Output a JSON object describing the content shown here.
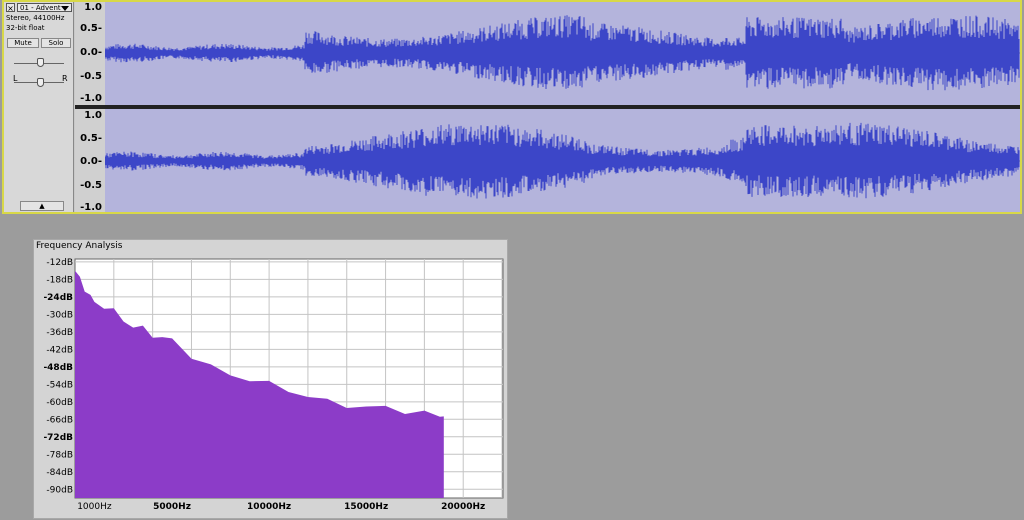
{
  "track": {
    "name": "01 - Advent",
    "info_line1": "Stereo, 44100Hz",
    "info_line2": "32-bit float",
    "mute_label": "Mute",
    "solo_label": "Solo",
    "gain_label_left": "L",
    "gain_label_right": "R",
    "close_glyph": "×",
    "collapse_glyph": "▲",
    "dropdown_icon": "triangle-down-icon",
    "ruler_ticks": [
      "1.0",
      "0.5-",
      "0.0-",
      "-0.5",
      "-1.0"
    ],
    "waveform_color": "#3c46c8",
    "waveform_bg": "#b4b4dc",
    "selection_border": "#d8d848"
  },
  "frequency_window": {
    "title": "Frequency Analysis",
    "fill_color": "#8c3cc8"
  },
  "chart_data": {
    "type": "area",
    "y_ticks": [
      "-12dB",
      "-18dB",
      "-24dB",
      "-30dB",
      "-36dB",
      "-42dB",
      "-48dB",
      "-54dB",
      "-60dB",
      "-66dB",
      "-72dB",
      "-78dB",
      "-84dB",
      "-90dB"
    ],
    "x_ticks": [
      "1000Hz",
      "5000Hz",
      "10000Hz",
      "15000Hz",
      "20000Hz"
    ],
    "x_tick_values": [
      1000,
      5000,
      10000,
      15000,
      20000
    ],
    "xlim": [
      0,
      22050
    ],
    "ylim": [
      -93,
      -11
    ],
    "series": [
      {
        "x": [
          0,
          250,
          500,
          800,
          1000,
          1500,
          2000,
          2500,
          3000,
          3500,
          4000,
          4500,
          5000,
          6000,
          7000,
          8000,
          9000,
          10000,
          11000,
          12000,
          13000,
          14000,
          15000,
          16000,
          17000,
          18000,
          18800,
          19000
        ],
        "y": [
          -15,
          -18,
          -21,
          -24,
          -26,
          -27,
          -29,
          -32,
          -34,
          -35,
          -37,
          -38,
          -39,
          -44,
          -48,
          -51,
          -52,
          -54,
          -56,
          -58,
          -60,
          -61,
          -62,
          -62,
          -63,
          -64,
          -65,
          -65
        ]
      }
    ]
  }
}
